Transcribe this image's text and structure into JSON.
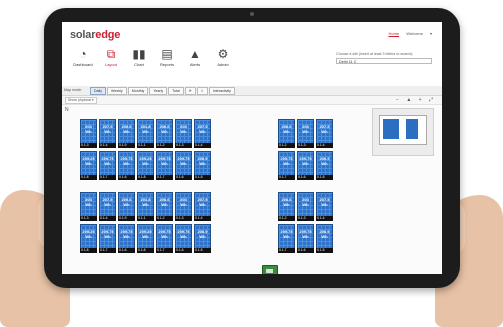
{
  "brand": {
    "part1": "solar",
    "part2": "edge"
  },
  "top_links": {
    "home": "Home",
    "welcome": "Welcome"
  },
  "nav": [
    {
      "label": "Dashboard",
      "icon": "dashboard-gauge-icon"
    },
    {
      "label": "Layout",
      "icon": "layout-sitemap-icon"
    },
    {
      "label": "Chart",
      "icon": "bar-chart-icon"
    },
    {
      "label": "Reports",
      "icon": "reports-doc-icon"
    },
    {
      "label": "Alerts",
      "icon": "warning-triangle-icon"
    },
    {
      "label": "Admin",
      "icon": "gears-icon"
    }
  ],
  "site_search": {
    "hint": "Choose a site (insert at least 3 letters to search):",
    "value": "Delhi 11 C"
  },
  "toolbar": {
    "label": "Map mode:",
    "tabs": [
      "Daily",
      "Weekly",
      "Monthly",
      "Yearly",
      "Total"
    ],
    "extra": "Interactivity"
  },
  "subbar": {
    "select": "Show physical ▾",
    "zoom": "− ▲ + ⤢"
  },
  "panels": [
    {
      "v": "203",
      "u": "Wh",
      "id": "0.1.3"
    },
    {
      "v": "207.5",
      "u": "Wh",
      "id": "0.1.4"
    },
    {
      "v": "200.6",
      "u": "Wh",
      "id": "0.1.9"
    },
    {
      "v": "201.8",
      "u": "Wh",
      "id": "0.1.1"
    },
    {
      "v": "206.6",
      "u": "Wh",
      "id": "0.1.2"
    },
    {
      "v": "203",
      "u": "Wh",
      "id": "0.1.3"
    },
    {
      "v": "207.5",
      "u": "Wh",
      "id": "0.1.4"
    },
    {
      "v": "209.25",
      "u": "Wh",
      "id": "0.1.8"
    },
    {
      "v": "209.75",
      "u": "Wh",
      "id": "0.1.7"
    },
    {
      "v": "209.75",
      "u": "Wh",
      "id": "0.1.6"
    },
    {
      "v": "209.25",
      "u": "Wh",
      "id": "0.1.8"
    },
    {
      "v": "209.75",
      "u": "Wh",
      "id": "0.1.7"
    },
    {
      "v": "209.75",
      "u": "Wh",
      "id": "0.1.6"
    },
    {
      "v": "206.9",
      "u": "Wh",
      "id": "0.1.5"
    },
    {
      "v": "203",
      "u": "Wh",
      "id": "0.1.3"
    },
    {
      "v": "207.5",
      "u": "Wh",
      "id": "0.1.4"
    },
    {
      "v": "200.6",
      "u": "Wh",
      "id": "0.1.9"
    },
    {
      "v": "201.8",
      "u": "Wh",
      "id": "0.1.1"
    },
    {
      "v": "206.6",
      "u": "Wh",
      "id": "0.1.2"
    },
    {
      "v": "203",
      "u": "Wh",
      "id": "0.1.3"
    },
    {
      "v": "207.5",
      "u": "Wh",
      "id": "0.1.4"
    },
    {
      "v": "209.25",
      "u": "Wh",
      "id": "0.1.8"
    },
    {
      "v": "209.75",
      "u": "Wh",
      "id": "0.1.7"
    },
    {
      "v": "209.75",
      "u": "Wh",
      "id": "0.1.6"
    },
    {
      "v": "209.25",
      "u": "Wh",
      "id": "0.1.8"
    },
    {
      "v": "209.75",
      "u": "Wh",
      "id": "0.1.7"
    },
    {
      "v": "209.75",
      "u": "Wh",
      "id": "0.1.6"
    },
    {
      "v": "206.9",
      "u": "Wh",
      "id": "0.1.5"
    }
  ],
  "panels_right": [
    {
      "v": "206.6",
      "u": "Wh",
      "id": "0.1.2"
    },
    {
      "v": "203",
      "u": "Wh",
      "id": "0.1.3"
    },
    {
      "v": "207.5",
      "u": "Wh",
      "id": "0.1.4"
    },
    {
      "v": "209.75",
      "u": "Wh",
      "id": "0.1.7"
    },
    {
      "v": "209.75",
      "u": "Wh",
      "id": "0.1.6"
    },
    {
      "v": "206.9",
      "u": "Wh",
      "id": "0.1.5"
    },
    {
      "v": "206.6",
      "u": "Wh",
      "id": "0.1.2"
    },
    {
      "v": "203",
      "u": "Wh",
      "id": "0.1.3"
    },
    {
      "v": "207.5",
      "u": "Wh",
      "id": "0.1.4"
    },
    {
      "v": "209.75",
      "u": "Wh",
      "id": "0.1.7"
    },
    {
      "v": "209.75",
      "u": "Wh",
      "id": "0.1.6"
    },
    {
      "v": "206.9",
      "u": "Wh",
      "id": "0.1.5"
    }
  ]
}
